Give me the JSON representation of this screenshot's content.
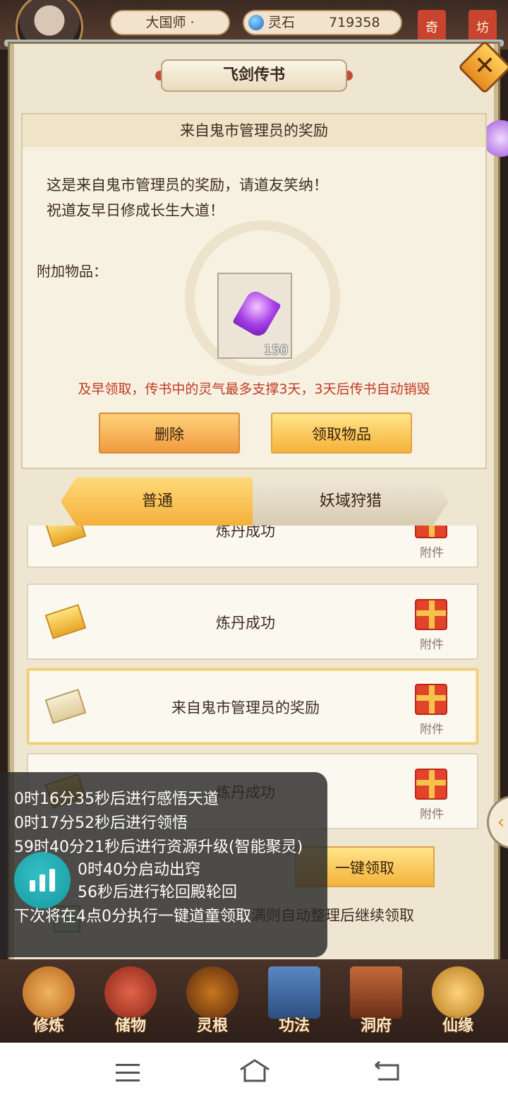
{
  "topbar": {
    "player_name": "大国师 ·",
    "currency_label": "灵石",
    "currency_value": "719358",
    "side_tabs": [
      "奇",
      "坊"
    ]
  },
  "dialog": {
    "title": "飞剑传书",
    "detail": {
      "heading": "来自鬼市管理员的奖励",
      "body_lines": [
        "这是来自鬼市管理员的奖励，请道友笑纳！",
        "祝道友早日修成长生大道！"
      ],
      "attachment_label": "附加物品：",
      "item": {
        "icon": "purple-spirit-stone-icon",
        "quantity": "150"
      },
      "warning": "及早领取，传书中的灵气最多支撑3天，3天后传书自动销毁",
      "delete_label": "删除",
      "collect_label": "领取物品"
    },
    "tabs": [
      {
        "label": "普通",
        "active": true
      },
      {
        "label": "妖域狩猎",
        "active": false
      }
    ],
    "mail_list": [
      {
        "title": "炼丹成功",
        "attachment_label": "附件",
        "opened": false
      },
      {
        "title": "炼丹成功",
        "attachment_label": "附件",
        "opened": false
      },
      {
        "title": "来自鬼市管理员的奖励",
        "attachment_label": "附件",
        "opened": true
      },
      {
        "title": "炼丹成功",
        "attachment_label": "附件",
        "opened": false
      }
    ],
    "one_key_label": "一键领取",
    "auto_text": "满则自动整理后继续领取"
  },
  "overlay_log": [
    "0时16分35秒后进行感悟天道",
    "0时17分52秒后进行领悟",
    "59时40分21秒后进行资源升级(智能聚灵)",
    "0时40分启动出窍",
    "56秒后进行轮回殿轮回",
    "下次将在4点0分执行一键道童领取"
  ],
  "game_nav": [
    {
      "label": "修炼",
      "color": "#d88a2e"
    },
    {
      "label": "储物",
      "color": "#b8402a"
    },
    {
      "label": "灵根",
      "color": "#8a3a18"
    },
    {
      "label": "功法",
      "color": "#3f6aa0"
    },
    {
      "label": "洞府",
      "color": "#a0522d"
    },
    {
      "label": "仙缘",
      "color": "#d9a13a"
    }
  ]
}
